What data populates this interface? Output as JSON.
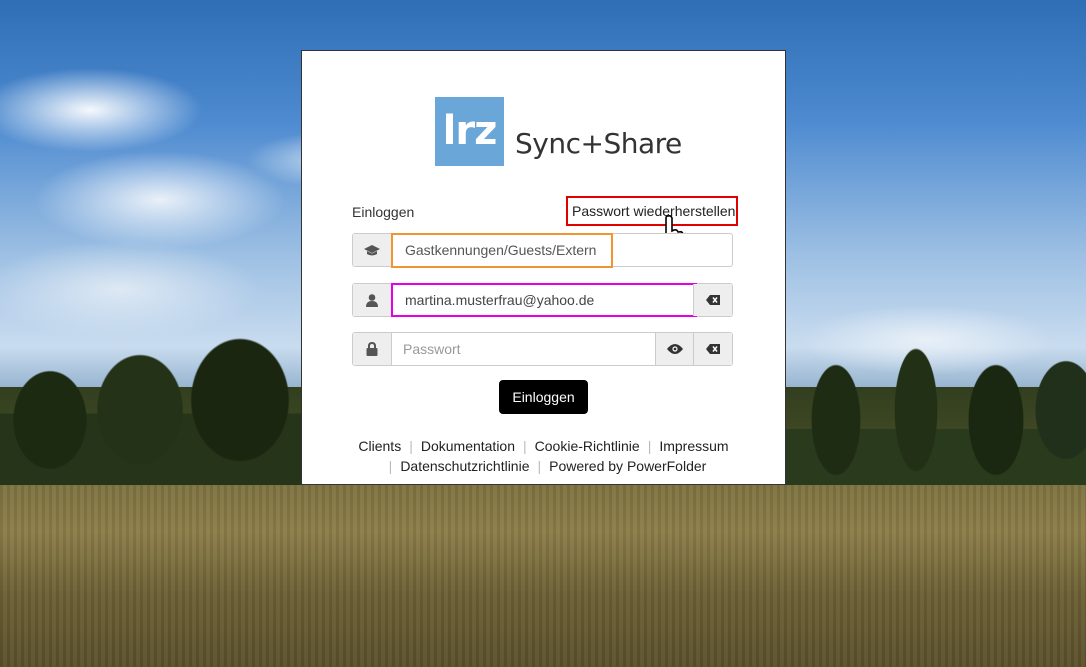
{
  "logo": {
    "mark": "lrz",
    "text": "Sync+Share",
    "mark_color": "#6aa6d8"
  },
  "login": {
    "heading": "Einloggen",
    "reset_password_link": "Passwort wiederherstellen",
    "organization": {
      "value": "Gastkennungen/Guests/Extern",
      "icon": "graduation-cap-icon"
    },
    "username": {
      "value": "martina.musterfrau@yahoo.de",
      "icon": "user-icon",
      "clear_icon": "backspace-icon"
    },
    "password": {
      "placeholder": "Passwort",
      "icon": "lock-icon",
      "show_icon": "eye-icon",
      "clear_icon": "backspace-icon"
    },
    "submit_label": "Einloggen"
  },
  "footer": {
    "links": [
      "Clients",
      "Dokumentation",
      "Cookie-Richtlinie",
      "Impressum",
      "Datenschutzrichtlinie",
      "Powered by PowerFolder"
    ],
    "separator": "|"
  },
  "highlights": {
    "reset_link": "#e00000",
    "organization": "#f0962e",
    "username": "#e600e6"
  }
}
